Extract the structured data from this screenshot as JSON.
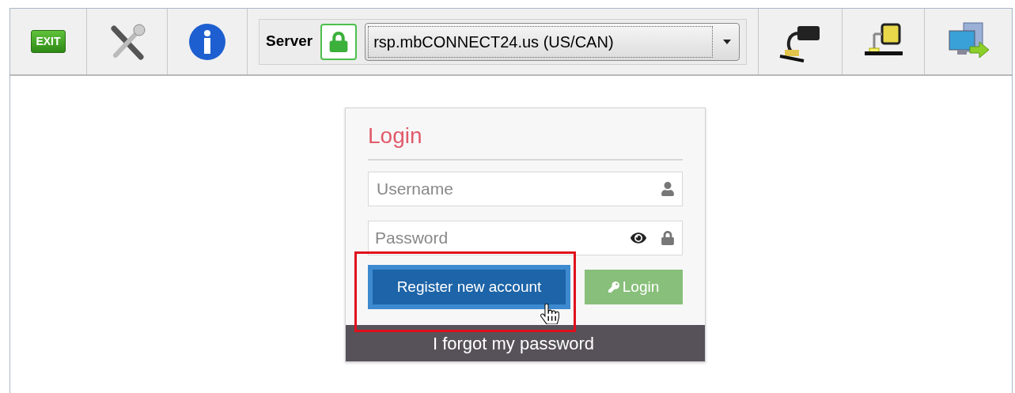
{
  "toolbar": {
    "exit_label": "EXIT",
    "server_label": "Server",
    "server_value": "rsp.mbCONNECT24.us (US/CAN)"
  },
  "login": {
    "title": "Login",
    "username": {
      "placeholder": "Username"
    },
    "password": {
      "placeholder": "Password"
    },
    "register_button": "Register new account",
    "login_button": "Login",
    "forgot_link": "I forgot my password"
  }
}
